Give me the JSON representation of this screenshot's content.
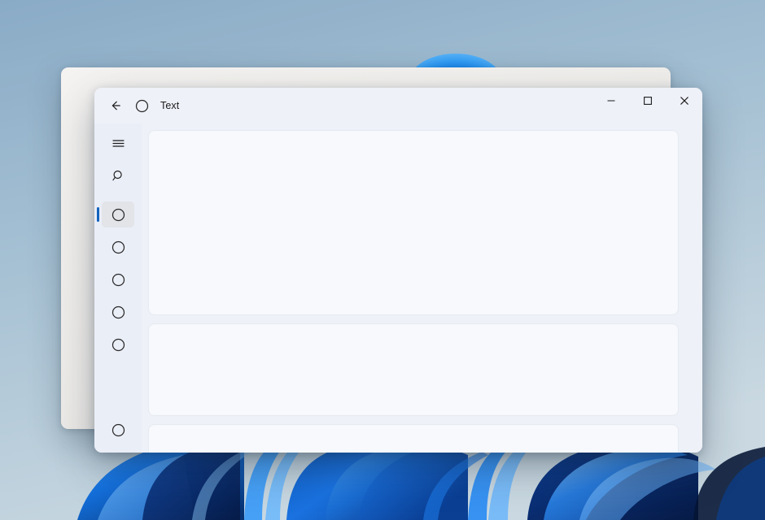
{
  "desktop": {
    "wallpaper_name": "windows-11-bloom-wallpaper",
    "background_top_color": "#85a8c4",
    "background_bottom_color": "#c9d8e1",
    "bloom_accent_color": "#1784ea"
  },
  "background_window": {
    "name": "inactive-background-window",
    "surface_color": "#f1efec"
  },
  "app_window": {
    "titlebar": {
      "back_label": "",
      "back_icon": "arrow-left-icon",
      "app_icon": "circle-icon",
      "title": "Text",
      "controls": [
        {
          "name": "minimize-button",
          "icon": "minimize-icon",
          "label": ""
        },
        {
          "name": "maximize-button",
          "icon": "maximize-icon",
          "label": ""
        },
        {
          "name": "close-button",
          "icon": "close-icon",
          "label": ""
        }
      ]
    },
    "sidebar": {
      "background_color": "#eaeef7",
      "selected_indicator_color": "#1262bd",
      "selected_item_background": "#e2e4e8",
      "items": [
        {
          "name": "nav-toggle",
          "icon": "hamburger-menu-icon",
          "label": "",
          "selected": false
        },
        {
          "name": "nav-search",
          "icon": "search-icon",
          "label": "",
          "selected": false
        },
        {
          "name": "nav-item-1",
          "icon": "circle-icon",
          "label": "",
          "selected": true
        },
        {
          "name": "nav-item-2",
          "icon": "circle-icon",
          "label": "",
          "selected": false
        },
        {
          "name": "nav-item-3",
          "icon": "circle-icon",
          "label": "",
          "selected": false
        },
        {
          "name": "nav-item-4",
          "icon": "circle-icon",
          "label": "",
          "selected": false
        },
        {
          "name": "nav-item-5",
          "icon": "circle-icon",
          "label": "",
          "selected": false
        }
      ],
      "bottom_item": {
        "name": "nav-settings",
        "icon": "circle-icon",
        "label": "",
        "selected": false
      }
    },
    "content": {
      "background_color": "#eef1f8",
      "card_color": "#f7f9fc",
      "cards": [
        {
          "name": "content-card-1",
          "text": ""
        },
        {
          "name": "content-card-2",
          "text": ""
        },
        {
          "name": "content-card-3",
          "text": ""
        }
      ]
    }
  }
}
